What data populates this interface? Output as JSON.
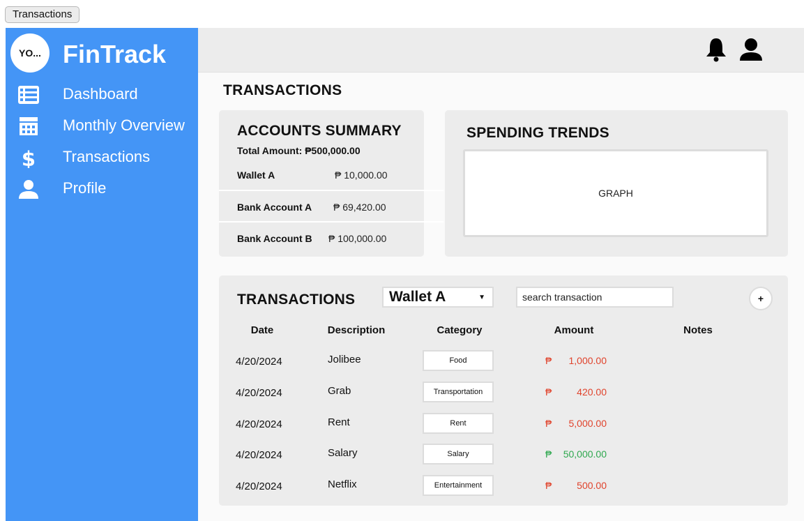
{
  "window": {
    "tab_label": "Transactions"
  },
  "sidebar": {
    "avatar_text": "YO...",
    "brand": "FinTrack",
    "items": [
      {
        "label": "Dashboard",
        "icon": "list-icon"
      },
      {
        "label": "Monthly Overview",
        "icon": "calendar-icon"
      },
      {
        "label": "Transactions",
        "icon": "dollar-icon"
      },
      {
        "label": "Profile",
        "icon": "user-icon"
      }
    ]
  },
  "topbar": {
    "icons": [
      "bell-icon",
      "user-profile-icon"
    ]
  },
  "page": {
    "title": "TRANSACTIONS"
  },
  "accounts_summary": {
    "title": "ACCOUNTS SUMMARY",
    "total": "Total Amount: ₱500,000.00",
    "accounts": [
      {
        "name": "Wallet A",
        "amount": "₱ 10,000.00"
      },
      {
        "name": "Bank Account A",
        "amount": "₱ 69,420.00"
      },
      {
        "name": "Bank Account B",
        "amount": "₱ 100,000.00"
      }
    ]
  },
  "spending_trends": {
    "title": "SPENDING TRENDS",
    "graph_placeholder": "GRAPH"
  },
  "transactions": {
    "title": "TRANSACTIONS",
    "wallet_selected": "Wallet A",
    "search_placeholder": "search transaction",
    "add_label": "+",
    "columns": [
      "Date",
      "Description",
      "Category",
      "Amount",
      "Notes"
    ],
    "currency_symbol": "₱",
    "rows": [
      {
        "date": "4/20/2024",
        "description": "Jolibee",
        "category": "Food",
        "amount": "1,000.00",
        "type": "expense",
        "notes": ""
      },
      {
        "date": "4/20/2024",
        "description": "Grab",
        "category": "Transportation",
        "amount": "420.00",
        "type": "expense",
        "notes": ""
      },
      {
        "date": "4/20/2024",
        "description": "Rent",
        "category": "Rent",
        "amount": "5,000.00",
        "type": "expense",
        "notes": ""
      },
      {
        "date": "4/20/2024",
        "description": "Salary",
        "category": "Salary",
        "amount": "50,000.00",
        "type": "income",
        "notes": ""
      },
      {
        "date": "4/20/2024",
        "description": "Netflix",
        "category": "Entertainment",
        "amount": "500.00",
        "type": "expense",
        "notes": ""
      }
    ]
  },
  "colors": {
    "sidebar": "#4495f6",
    "expense": "#e0432c",
    "income": "#2fa84f",
    "card": "#ececec"
  }
}
